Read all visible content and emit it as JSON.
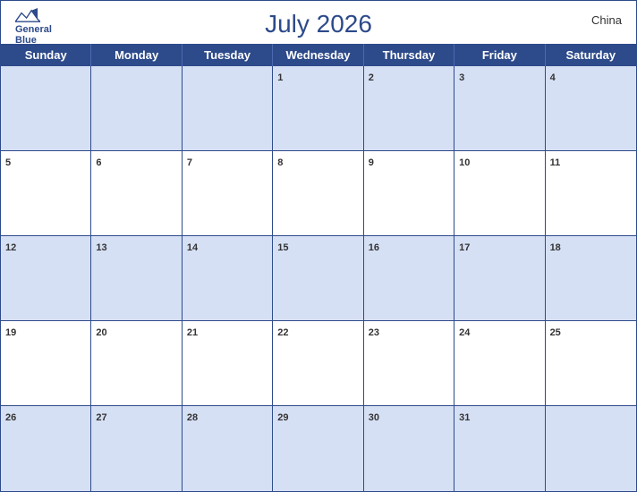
{
  "header": {
    "title": "July 2026",
    "country": "China",
    "logo_line1": "General",
    "logo_line2": "Blue"
  },
  "days_of_week": [
    "Sunday",
    "Monday",
    "Tuesday",
    "Wednesday",
    "Thursday",
    "Friday",
    "Saturday"
  ],
  "weeks": [
    [
      {
        "date": "",
        "empty": true
      },
      {
        "date": "",
        "empty": true
      },
      {
        "date": "",
        "empty": true
      },
      {
        "date": "1",
        "empty": false
      },
      {
        "date": "2",
        "empty": false
      },
      {
        "date": "3",
        "empty": false
      },
      {
        "date": "4",
        "empty": false
      }
    ],
    [
      {
        "date": "5",
        "empty": false
      },
      {
        "date": "6",
        "empty": false
      },
      {
        "date": "7",
        "empty": false
      },
      {
        "date": "8",
        "empty": false
      },
      {
        "date": "9",
        "empty": false
      },
      {
        "date": "10",
        "empty": false
      },
      {
        "date": "11",
        "empty": false
      }
    ],
    [
      {
        "date": "12",
        "empty": false
      },
      {
        "date": "13",
        "empty": false
      },
      {
        "date": "14",
        "empty": false
      },
      {
        "date": "15",
        "empty": false
      },
      {
        "date": "16",
        "empty": false
      },
      {
        "date": "17",
        "empty": false
      },
      {
        "date": "18",
        "empty": false
      }
    ],
    [
      {
        "date": "19",
        "empty": false
      },
      {
        "date": "20",
        "empty": false
      },
      {
        "date": "21",
        "empty": false
      },
      {
        "date": "22",
        "empty": false
      },
      {
        "date": "23",
        "empty": false
      },
      {
        "date": "24",
        "empty": false
      },
      {
        "date": "25",
        "empty": false
      }
    ],
    [
      {
        "date": "26",
        "empty": false
      },
      {
        "date": "27",
        "empty": false
      },
      {
        "date": "28",
        "empty": false
      },
      {
        "date": "29",
        "empty": false
      },
      {
        "date": "30",
        "empty": false
      },
      {
        "date": "31",
        "empty": false
      },
      {
        "date": "",
        "empty": true
      }
    ]
  ],
  "colors": {
    "header_bg": "#2d4a8a",
    "row_odd_bg": "#d6e0f5",
    "row_even_bg": "#ffffff",
    "border": "#2d4a8a",
    "title": "#2d4a8a",
    "logo": "#2d4a8a"
  }
}
